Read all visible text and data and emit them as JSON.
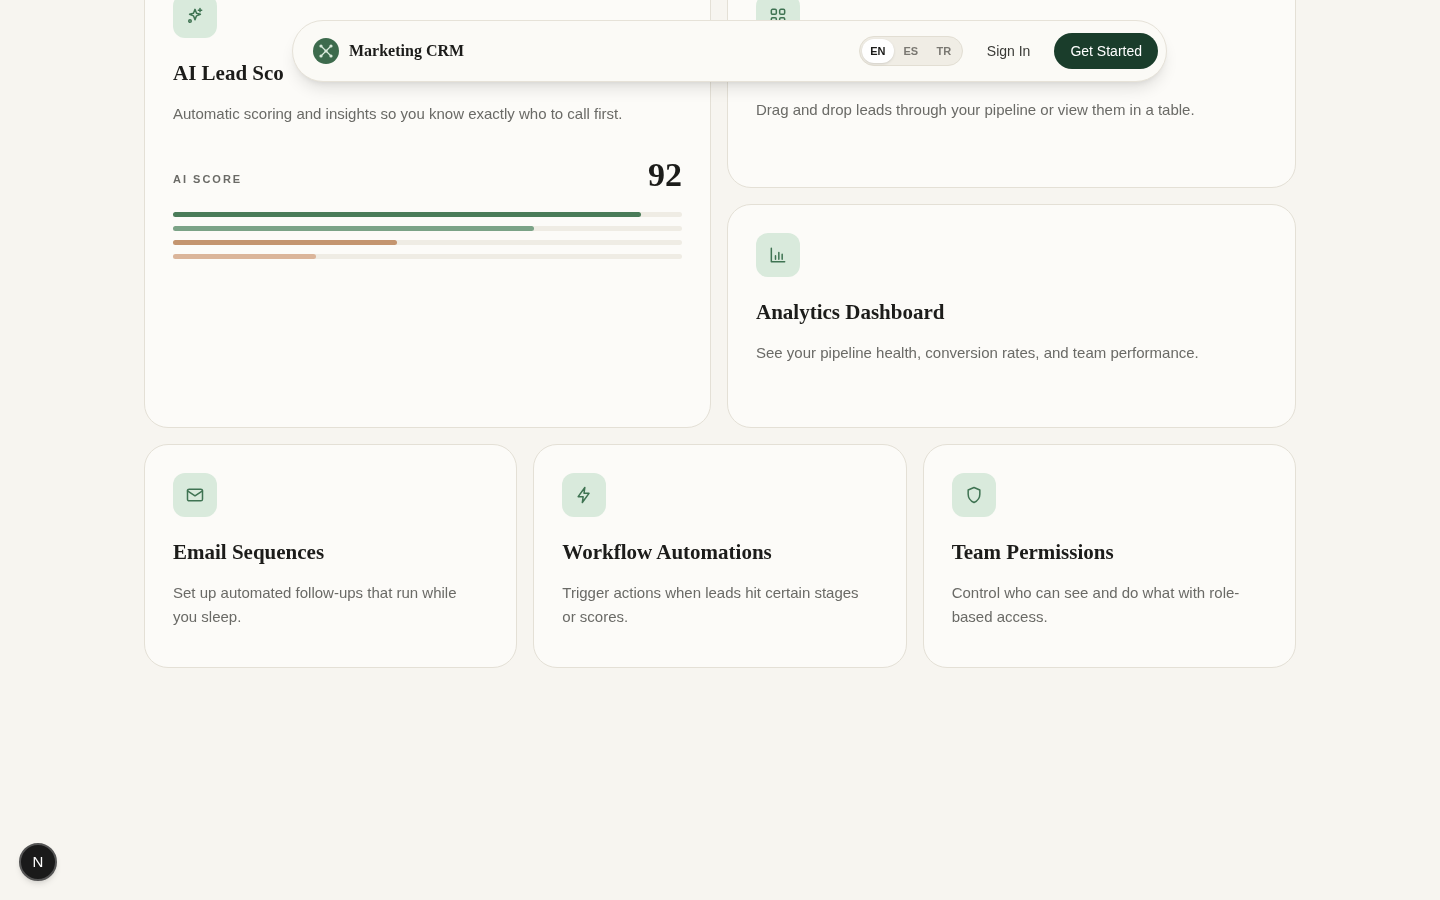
{
  "nav": {
    "brand": "Marketing CRM",
    "languages": [
      {
        "label": "EN",
        "selected": true
      },
      {
        "label": "ES",
        "selected": false
      },
      {
        "label": "TR",
        "selected": false
      }
    ],
    "sign_in": "Sign In",
    "cta": "Get Started"
  },
  "lead_card": {
    "kind": "sparkles",
    "title": "AI Lead Sco",
    "description": "Automatic scoring and insights so you know exactly who to call first.",
    "score_label": "AI SCORE",
    "score": "92",
    "bars": [
      {
        "level": 0.92,
        "color": "#4a7c59"
      },
      {
        "level": 0.71,
        "color": "#7ba387"
      },
      {
        "level": 0.44,
        "color": "#c4956f"
      },
      {
        "level": 0.28,
        "color": "#dbb59a"
      }
    ]
  },
  "side_cards": [
    {
      "kind": "grid",
      "description": "Drag and drop leads through your pipeline or view them in a table."
    },
    {
      "kind": "chart",
      "title": "Analytics Dashboard",
      "description": "See your pipeline health, conversion rates, and team performance."
    }
  ],
  "feature_cards": [
    {
      "kind": "mail",
      "title": "Email Sequences",
      "description": "Set up automated follow-ups that run while you sleep."
    },
    {
      "kind": "zap",
      "title": "Workflow Automations",
      "description": "Trigger actions when leads hit certain stages or scores."
    },
    {
      "kind": "shield",
      "title": "Team Permissions",
      "description": "Control who can see and do what with role-based access."
    }
  ],
  "dev_badge": "N"
}
